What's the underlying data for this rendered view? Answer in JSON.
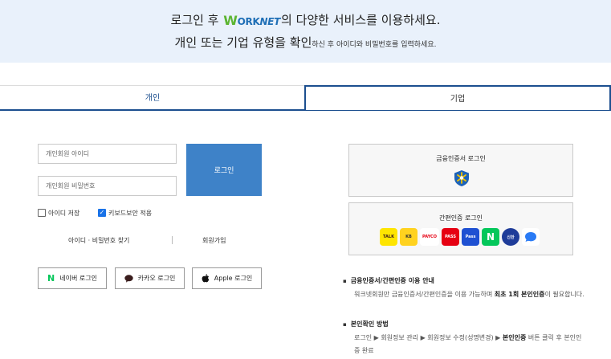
{
  "banner": {
    "line1_prefix": "로그인 후",
    "logo_w": "W",
    "logo_ork": "ORK",
    "logo_net": "NET",
    "line1_suffix": "의 다양한 서비스를 이용하세요.",
    "line2_main": "개인 또는 기업 유형을 확인",
    "line2_small": "하신 후 아이디와 비밀번호를 입력하세요."
  },
  "tabs": {
    "personal": "개인",
    "company": "기업"
  },
  "login": {
    "id_placeholder": "개인회원 아이디",
    "pw_placeholder": "개인회원 비밀번호",
    "login_button": "로그인",
    "save_id_label": "아이디 저장",
    "save_id_checked": false,
    "keyboard_security_label": "키보드보안 적용",
    "keyboard_security_checked": true,
    "find_link": "아이디 · 비밀번호 찾기",
    "join_link": "회원가입"
  },
  "sns": {
    "naver": "네이버 로그인",
    "kakao": "카카오 로그인",
    "apple": "Apple 로그인"
  },
  "cert": {
    "financial_title": "금융인증서 로그인",
    "simple_title": "간편인증 로그인",
    "providers": [
      {
        "name": "kakao",
        "label": "TALK"
      },
      {
        "name": "kb",
        "label": "KB"
      },
      {
        "name": "payco",
        "label": "PAYCO"
      },
      {
        "name": "pass",
        "label": "PASS"
      },
      {
        "name": "samsung-pass",
        "label": "Pass"
      },
      {
        "name": "naver",
        "label": "N"
      },
      {
        "name": "shinhan",
        "label": "신한"
      },
      {
        "name": "toss",
        "label": ""
      }
    ]
  },
  "info": {
    "h1": "금융인증서/간편인증 이용 안내",
    "b1_pre": "워크넷회원만 금융인증서/간편인증을 이용 가능하며 ",
    "b1_bold": "최초 1회 본인인증",
    "b1_post": "이 필요합니다.",
    "h2": "본인확인 방법",
    "b2_pre": "로그인 ▶ 회원정보 관리 ▶ 회원정보 수정(성명변경) ▶ ",
    "b2_bold": "본인인증",
    "b2_post": " 버튼 클릭 후 본인인증 완료"
  },
  "colors": {
    "accent": "#3e82c8",
    "tab_active": "#1c4f8f",
    "banner_bg": "#e9f1fb"
  }
}
